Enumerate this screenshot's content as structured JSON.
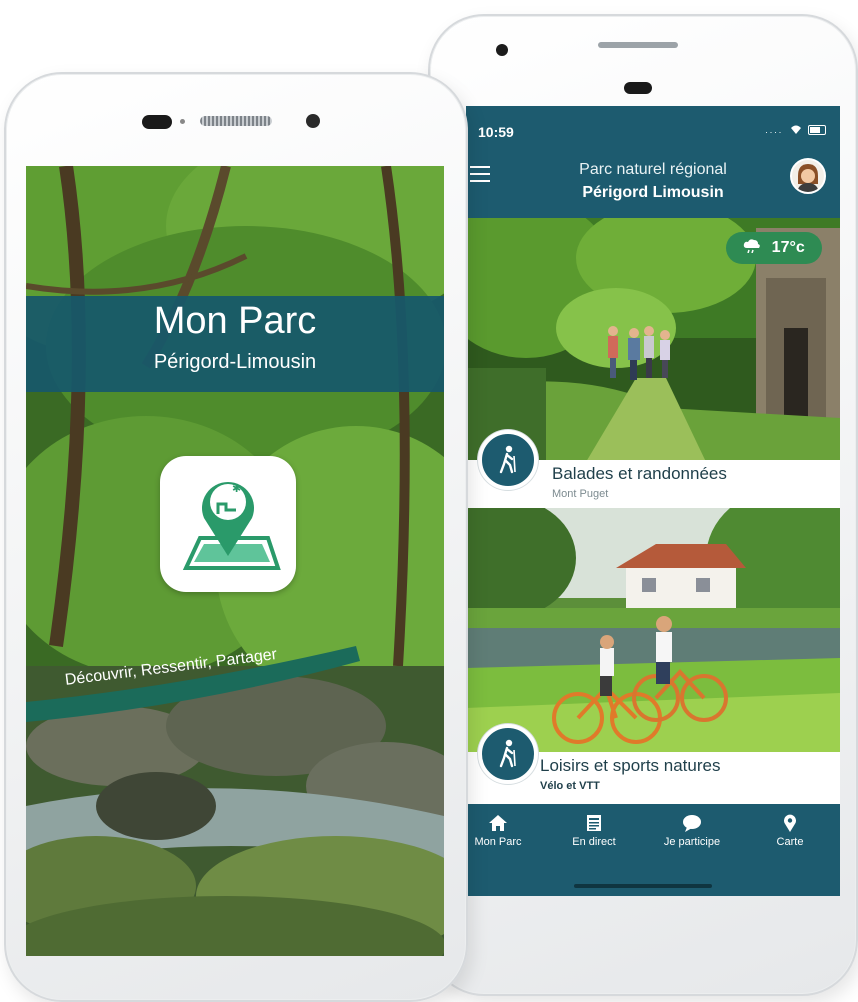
{
  "left_phone": {
    "title": "Mon Parc",
    "subtitle": "Périgord-Limousin",
    "tagline": "Découvrir, Ressentir, Partager",
    "icon": "map-pin-park-icon"
  },
  "right_phone": {
    "status_time": "10:59",
    "status_icons": "....",
    "header": {
      "line1": "Parc naturel régional",
      "line2": "Périgord Limousin"
    },
    "weather": {
      "icon": "cloud-rain-icon",
      "temperature": "17°c"
    },
    "cards": [
      {
        "title": "Balades et randonnées",
        "subtitle": "Mont Puget",
        "icon": "hiker-icon"
      },
      {
        "title": "Loisirs et sports natures",
        "subtitle": "Vélo et VTT",
        "icon": "hiker-icon"
      }
    ],
    "tabs": [
      {
        "label": "Mon Parc",
        "icon": "home-icon"
      },
      {
        "label": "En direct",
        "icon": "news-icon"
      },
      {
        "label": "Je participe",
        "icon": "chat-icon"
      },
      {
        "label": "Carte",
        "icon": "map-pin-icon"
      }
    ]
  },
  "colors": {
    "primary": "#1d5b6f",
    "accent_green": "#2e8b53",
    "banner_teal": "#17586a"
  }
}
